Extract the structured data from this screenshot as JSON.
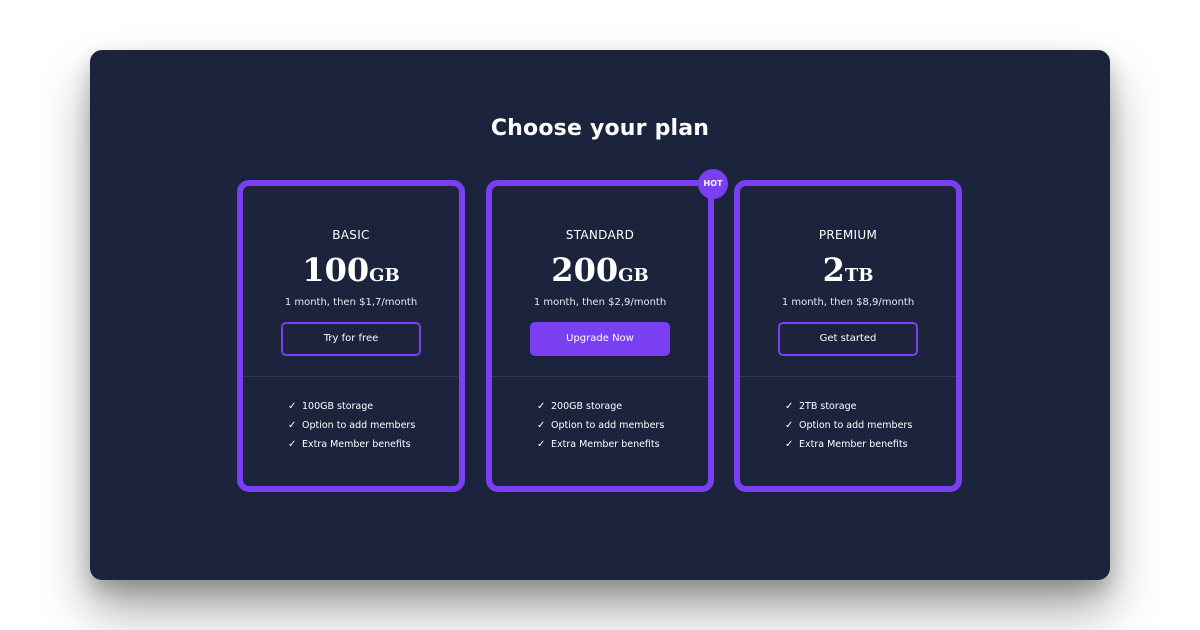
{
  "title": "Choose your plan",
  "plans": [
    {
      "name": "BASIC",
      "size": "100",
      "unit": "GB",
      "price_text": "1 month, then $1,7/month",
      "button": "Try for free",
      "features": [
        "100GB storage",
        "Option to add members",
        "Extra Member benefits"
      ]
    },
    {
      "name": "STANDARD",
      "size": "200",
      "unit": "GB",
      "price_text": "1 month, then $2,9/month",
      "button": "Upgrade Now",
      "badge": "HOT",
      "features": [
        "200GB storage",
        "Option to add members",
        "Extra Member benefits"
      ]
    },
    {
      "name": "PREMIUM",
      "size": "2",
      "unit": "TB",
      "price_text": "1 month, then $8,9/month",
      "button": "Get started",
      "features": [
        "2TB storage",
        "Option to add members",
        "Extra Member benefits"
      ]
    }
  ],
  "icons": {
    "feature_check": "check-icon"
  },
  "colors": {
    "background": "#1c243d",
    "accent": "#7b3ff2",
    "text": "#ffffff"
  }
}
